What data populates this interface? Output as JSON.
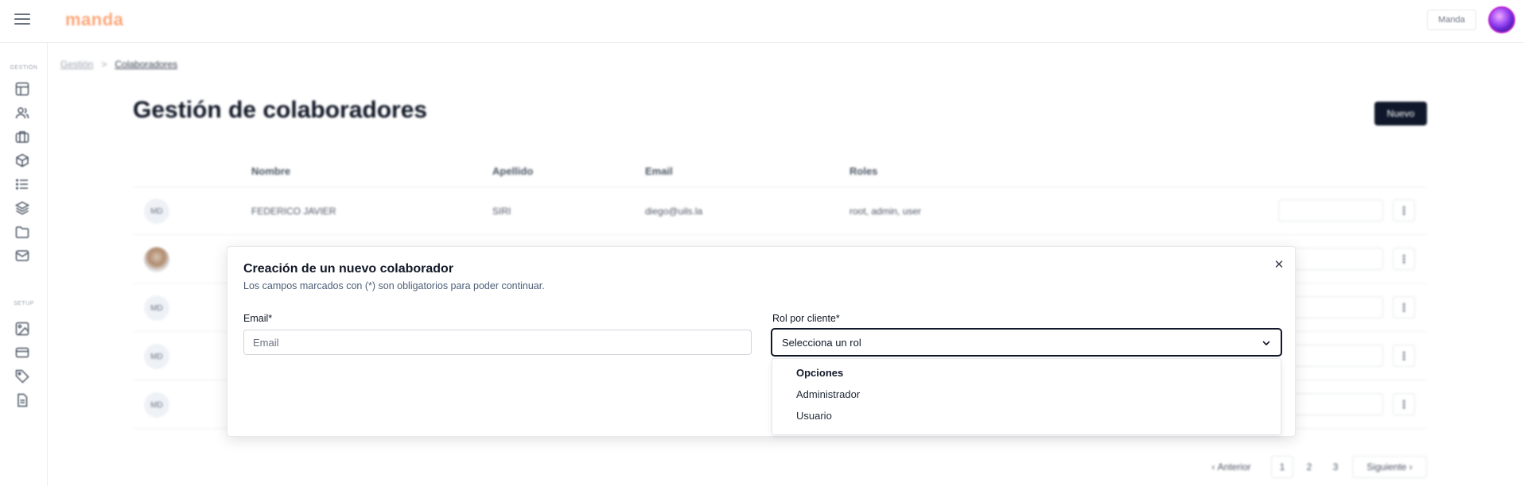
{
  "app": {
    "logo": "manda",
    "account_button": "Manda"
  },
  "sidebar": {
    "sections": [
      "GESTIÓN",
      "SETUP"
    ],
    "gestion_icons": [
      "layout-icon",
      "users-icon",
      "briefcase-icon",
      "cube-icon",
      "list-icon",
      "layers-icon",
      "folder-icon",
      "mail-icon"
    ],
    "setup_icons": [
      "image-icon",
      "card-icon",
      "tag-icon",
      "document-icon"
    ]
  },
  "breadcrumb": {
    "parent": "Gestión",
    "separator": ">",
    "current": "Colaboradores"
  },
  "page": {
    "title": "Gestión de colaboradores",
    "new_button": "Nuevo"
  },
  "table": {
    "headers": [
      "Nombre",
      "Apellido",
      "Email",
      "Roles"
    ],
    "rows": [
      {
        "initials": "MD",
        "nombre": "FEDERICO JAVIER",
        "apellido": "SIRI",
        "email": "diego@uils.la",
        "roles": "root, admin, user",
        "photo": false
      },
      {
        "initials": "",
        "nombre": "",
        "apellido": "",
        "email": "",
        "roles": "",
        "photo": true
      },
      {
        "initials": "MD",
        "nombre": "",
        "apellido": "",
        "email": "",
        "roles": "",
        "photo": false
      },
      {
        "initials": "MD",
        "nombre": "",
        "apellido": "",
        "email": "",
        "roles": "",
        "photo": false
      },
      {
        "initials": "MD",
        "nombre": "",
        "apellido": "",
        "email": "",
        "roles": "",
        "photo": false
      }
    ]
  },
  "pagination": {
    "prev": "Anterior",
    "pages": [
      "1",
      "2",
      "3"
    ],
    "next": "Siguiente"
  },
  "modal": {
    "title": "Creación de un nuevo colaborador",
    "subtitle": "Los campos marcados con (*) son obligatorios para poder continuar.",
    "email_label": "Email*",
    "email_placeholder": "Email",
    "email_value": "",
    "role_label": "Rol por cliente*",
    "role_selected": "Selecciona un rol",
    "dropdown": {
      "group_label": "Opciones",
      "options": [
        "Administrador",
        "Usuario"
      ]
    }
  },
  "colors": {
    "primary": "#0f172a",
    "brand": "#fca77a",
    "subtitle": "#4b5e78"
  }
}
